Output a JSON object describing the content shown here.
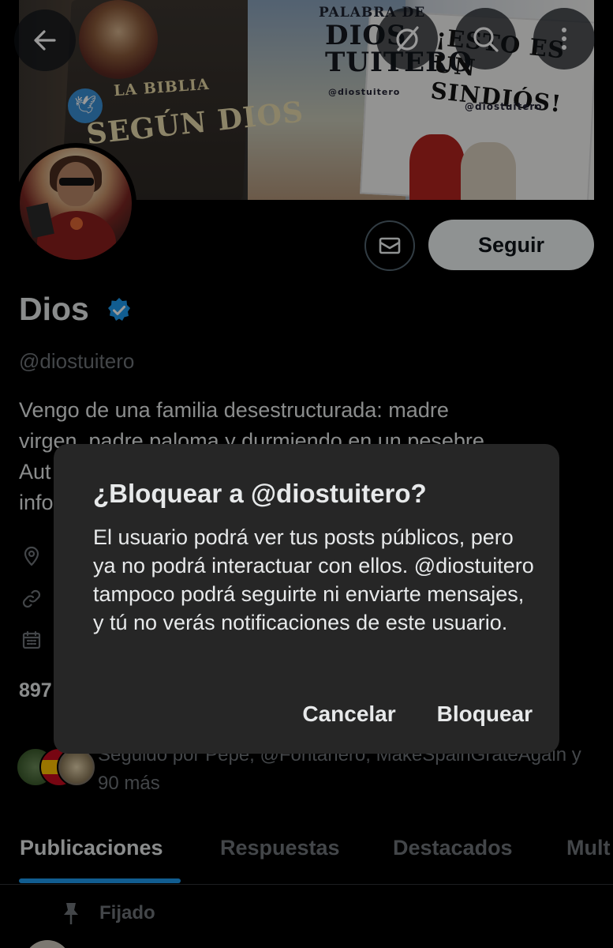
{
  "banner": {
    "texts": {
      "la_biblia": "LA BIBLIA",
      "segun_dios": "SEGÚN DIOS",
      "tuitero": "TUITERO",
      "palabra_de": "PALABRA DE",
      "dios_tuitero": "DIOS TUITERO",
      "esto_es": "¡ESTO ES UN SINDIÓS!",
      "handle_small_1": "@diostuitero",
      "handle_small_2": "@diostuitero"
    }
  },
  "top_bar": {
    "back_icon": "arrow-left-icon",
    "grok_icon": "slash-circle-icon",
    "search_icon": "search-icon",
    "more_icon": "more-vertical-icon"
  },
  "profile": {
    "message_icon": "envelope-icon",
    "follow_label": "Seguir",
    "name": "Dios",
    "verified_icon": "verified-badge-icon",
    "verified_color": "#1d9bf0",
    "handle": "@diostuitero",
    "bio_lines": [
      "Vengo de una familia desestructurada: madre",
      "virgen, padre paloma y durmiendo en un pesebre.",
      "Aut",
      "info"
    ],
    "meta": {
      "location_icon": "location-pin-icon",
      "link_icon": "link-icon",
      "calendar_icon": "calendar-icon"
    },
    "following_count_partial": "897",
    "followed_by": "Seguido por Pepe, @Fontanero, MakeSpainGrateAgain y 90 más"
  },
  "tabs": [
    {
      "label": "Publicaciones",
      "active": true
    },
    {
      "label": "Respuestas",
      "active": false
    },
    {
      "label": "Destacados",
      "active": false
    },
    {
      "label": "Mult",
      "active": false
    }
  ],
  "pinned": {
    "icon": "pin-icon",
    "label": "Fijado"
  },
  "dialog": {
    "title": "¿Bloquear a @diostuitero?",
    "body": "El usuario podrá ver tus posts públicos, pero ya no podrá interactuar con ellos. @diostuitero tampoco podrá seguirte ni enviarte mensajes, y tú no verás notificaciones de este usuario.",
    "cancel_label": "Cancelar",
    "confirm_label": "Bloquear"
  },
  "colors": {
    "background": "#000000",
    "text_primary": "#e7e9ea",
    "text_secondary": "#71767b",
    "accent": "#1d9bf0",
    "dialog_bg": "#262626",
    "follow_bg": "#eff3f4"
  }
}
